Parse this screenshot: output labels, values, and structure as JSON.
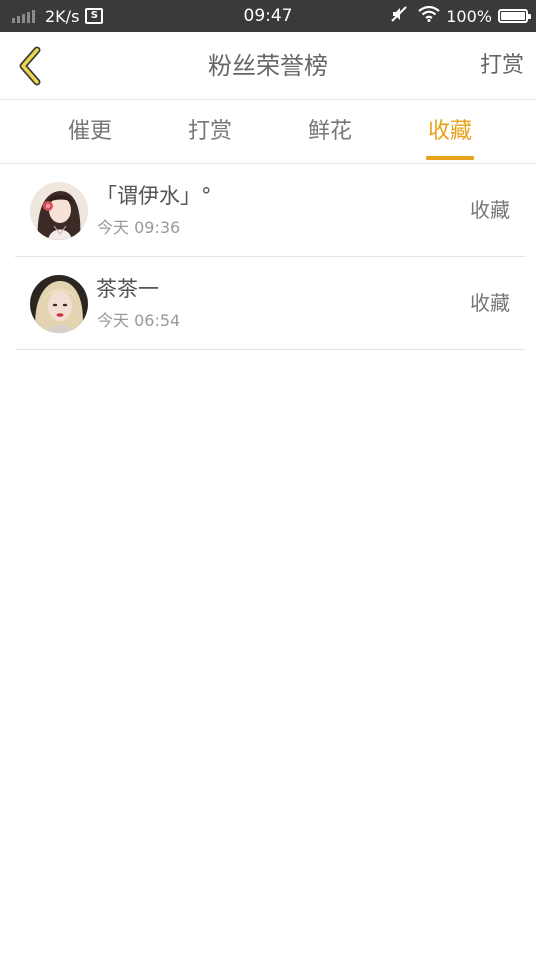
{
  "status_bar": {
    "speed": "2K/s",
    "s_icon": "S",
    "time": "09:47",
    "battery": "100%"
  },
  "header": {
    "title": "粉丝荣誉榜",
    "action": "打赏"
  },
  "tabs": [
    {
      "label": "催更",
      "active": false
    },
    {
      "label": "打赏",
      "active": false
    },
    {
      "label": "鲜花",
      "active": false
    },
    {
      "label": "收藏",
      "active": true
    }
  ],
  "list": [
    {
      "nickname": "「谓伊水」°",
      "time": "今天 09:36",
      "action": "收藏"
    },
    {
      "nickname": "茶茶一",
      "time": "今天 06:54",
      "action": "收藏"
    }
  ],
  "colors": {
    "accent": "#e8a21c",
    "status_bar_bg": "#3a3a3a",
    "text_primary": "#555555",
    "text_secondary": "#999999"
  },
  "icons": {
    "back": "chevron-left-icon",
    "signal": "signal-icon",
    "screenshot": "screenshot-s-icon",
    "mute": "mute-icon",
    "wifi": "wifi-icon",
    "battery": "battery-icon"
  }
}
